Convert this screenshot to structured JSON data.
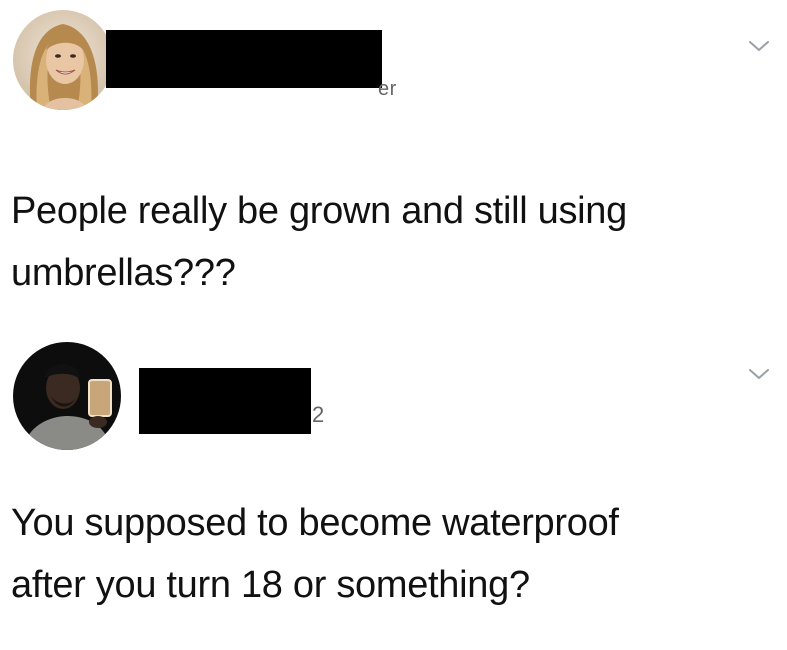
{
  "tweets": [
    {
      "handle_fragment": "er",
      "text": "People really be grown and still using\numbrellas???",
      "avatar_icon": "avatar-photo-woman",
      "menu_icon": "chevron-down-icon"
    },
    {
      "handle_fragment": "2",
      "text": "You supposed to become waterproof\nafter you turn 18 or something?",
      "avatar_icon": "avatar-photo-man",
      "menu_icon": "chevron-down-icon"
    }
  ],
  "colors": {
    "background": "#ffffff",
    "text": "#111111",
    "muted": "#666666",
    "redaction": "#000000",
    "chevron": "#9aa0a6"
  }
}
